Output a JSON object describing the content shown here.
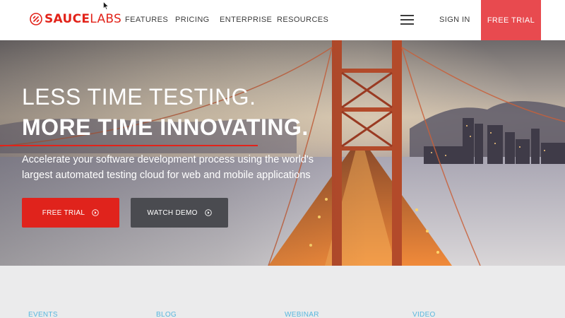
{
  "nav": {
    "logo_bold": "SAUCE",
    "logo_light": "LABS",
    "links": [
      "FEATURES",
      "PRICING",
      "ENTERPRISE",
      "RESOURCES"
    ],
    "menu_icon": "hamburger-icon",
    "signin": "SIGN IN",
    "cta": "FREE TRIAL"
  },
  "hero": {
    "headline_1": "LESS TIME TESTING.",
    "headline_2": "MORE TIME INNOVATING.",
    "subtitle": "Accelerate your software development process using the world's largest automated testing cloud for web and mobile applications",
    "primary_button": "FREE TRIAL",
    "secondary_button": "WATCH DEMO",
    "button_icon": "play-circle-icon"
  },
  "resources": {
    "links": [
      "EVENTS",
      "BLOG",
      "WEBINAR",
      "VIDEO"
    ]
  },
  "colors": {
    "brand_red": "#e2231a",
    "nav_cta_bg": "#e84a4f",
    "demo_button_bg": "#4a4b50",
    "link_blue": "#59b7de",
    "resources_bg": "#ebebec"
  }
}
